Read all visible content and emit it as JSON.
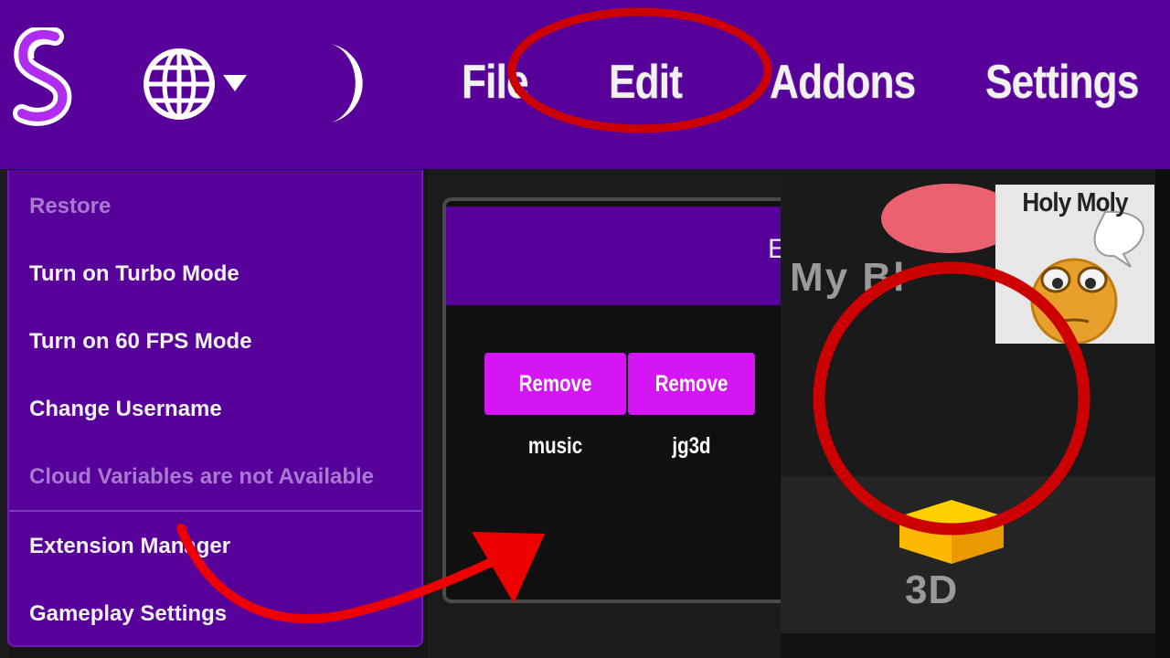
{
  "colors": {
    "menu_bar": "#58009a",
    "dropdown": "#58009a",
    "accent_button": "#d416f5",
    "annotation_red": "#cc0000"
  },
  "menubar": {
    "logo_icon": "sticker-s-logo-icon",
    "language_icon": "globe-icon",
    "theme_icon": "moon-icon",
    "items": [
      {
        "label": "File"
      },
      {
        "label": "Edit"
      },
      {
        "label": "Addons"
      },
      {
        "label": "Settings"
      }
    ]
  },
  "dropdown": {
    "items": [
      {
        "label": "Restore",
        "disabled": true
      },
      {
        "label": "Turn on Turbo Mode",
        "disabled": false
      },
      {
        "label": "Turn on 60 FPS Mode",
        "disabled": false
      },
      {
        "label": "Change Username",
        "disabled": false
      },
      {
        "label": "Cloud Variables are not Available",
        "disabled": true
      },
      {
        "label": "Extension Manager",
        "disabled": false
      },
      {
        "label": "Gameplay Settings",
        "disabled": false
      }
    ]
  },
  "modal": {
    "header_text": "E",
    "buttons": [
      {
        "label": "Remove music"
      },
      {
        "label": "Remove jg3d"
      }
    ]
  },
  "right_panel": {
    "peek_label": "My Bl",
    "extension_label": "3D",
    "extension_icon": "cube-icon"
  },
  "meme": {
    "text": "Holy Moly"
  }
}
